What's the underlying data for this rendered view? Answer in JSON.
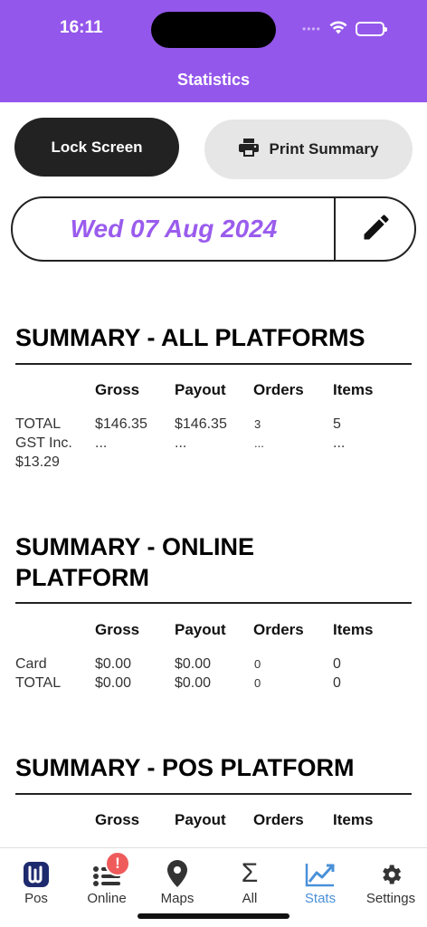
{
  "status": {
    "time": "16:11",
    "signal": "••••"
  },
  "header": {
    "title": "Statistics"
  },
  "actions": {
    "lock_label": "Lock Screen",
    "print_label": "Print Summary"
  },
  "date": {
    "value": "Wed 07 Aug 2024"
  },
  "columns": {
    "gross": "Gross",
    "payout": "Payout",
    "orders": "Orders",
    "items": "Items"
  },
  "summary_all": {
    "title": "SUMMARY - ALL PLATFORMS",
    "rows": [
      {
        "label": "TOTAL",
        "gross": "$146.35",
        "payout": "$146.35",
        "orders": "3",
        "items": "5"
      },
      {
        "label": "GST Inc.",
        "gross": "...",
        "payout": "...",
        "orders": "...",
        "items": "..."
      },
      {
        "label": "$13.29"
      }
    ]
  },
  "summary_online": {
    "title_line1": "SUMMARY - ONLINE",
    "title_line2": "PLATFORM",
    "rows": [
      {
        "label": "Card",
        "gross": "$0.00",
        "payout": "$0.00",
        "orders": "0",
        "items": "0"
      },
      {
        "label": "TOTAL",
        "gross": "$0.00",
        "payout": "$0.00",
        "orders": "0",
        "items": "0"
      }
    ]
  },
  "summary_pos": {
    "title": "SUMMARY - POS PLATFORM"
  },
  "tabs": [
    {
      "label": "Pos",
      "icon": "pos-logo-icon"
    },
    {
      "label": "Online",
      "icon": "list-icon",
      "badge": "!"
    },
    {
      "label": "Maps",
      "icon": "map-pin-icon"
    },
    {
      "label": "All",
      "icon": "sigma-icon",
      "glyph": "Σ"
    },
    {
      "label": "Stats",
      "icon": "chart-line-icon",
      "active": true
    },
    {
      "label": "Settings",
      "icon": "gear-icon"
    }
  ],
  "colors": {
    "header": "#9457eb",
    "accent": "#9a5ced",
    "active_tab": "#4a90d9",
    "badge": "#ef5b5b"
  }
}
